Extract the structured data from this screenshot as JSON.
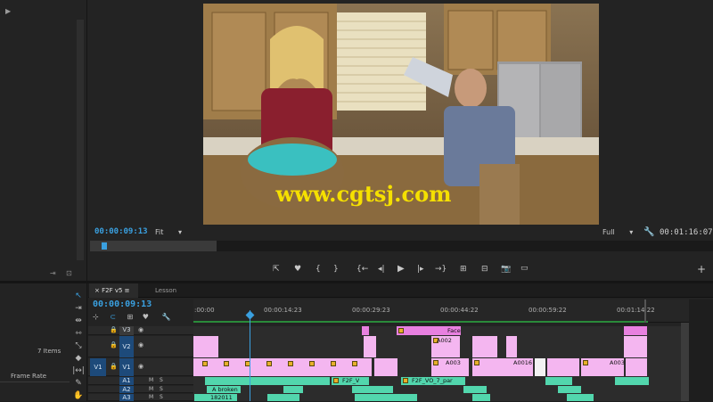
{
  "monitor": {
    "current_timecode": "00:00:09:13",
    "fit_label": "Fit",
    "quality_label": "Full",
    "duration_timecode": "00:01:16:07",
    "watermark": "www.cgtsj.com"
  },
  "timeline": {
    "tab_active": "F2F v5",
    "tab_other": "Lesson",
    "timecode": "00:00:09:13",
    "ruler_labels": [
      ":00:00",
      "00:00:14:23",
      "00:00:29:23",
      "00:00:44:22",
      "00:00:59:22",
      "00:01:14:22"
    ],
    "tracks": {
      "v3": "V3",
      "v2": "V2",
      "v1_source": "V1",
      "v1": "V1",
      "a1": "A1",
      "a2": "A2",
      "a3": "A3",
      "m": "M",
      "s": "S"
    },
    "clip_labels": {
      "face": "Face",
      "a002": "A002",
      "a003": "A003",
      "a0016": "A0016",
      "a003b": "A003",
      "f2f_v": "F2F_V",
      "f2f_vo7": "F2F_VO_7_par",
      "a_broken": "A broken",
      "num_182011": "182011"
    }
  },
  "project": {
    "items_count": "7 Items",
    "frame_rate_label": "Frame Rate"
  },
  "colors": {
    "accent": "#3aa0e0",
    "video_clip": "#f4b6f0",
    "audio_clip": "#52d6ad",
    "track_blue": "#1d4a7a"
  }
}
